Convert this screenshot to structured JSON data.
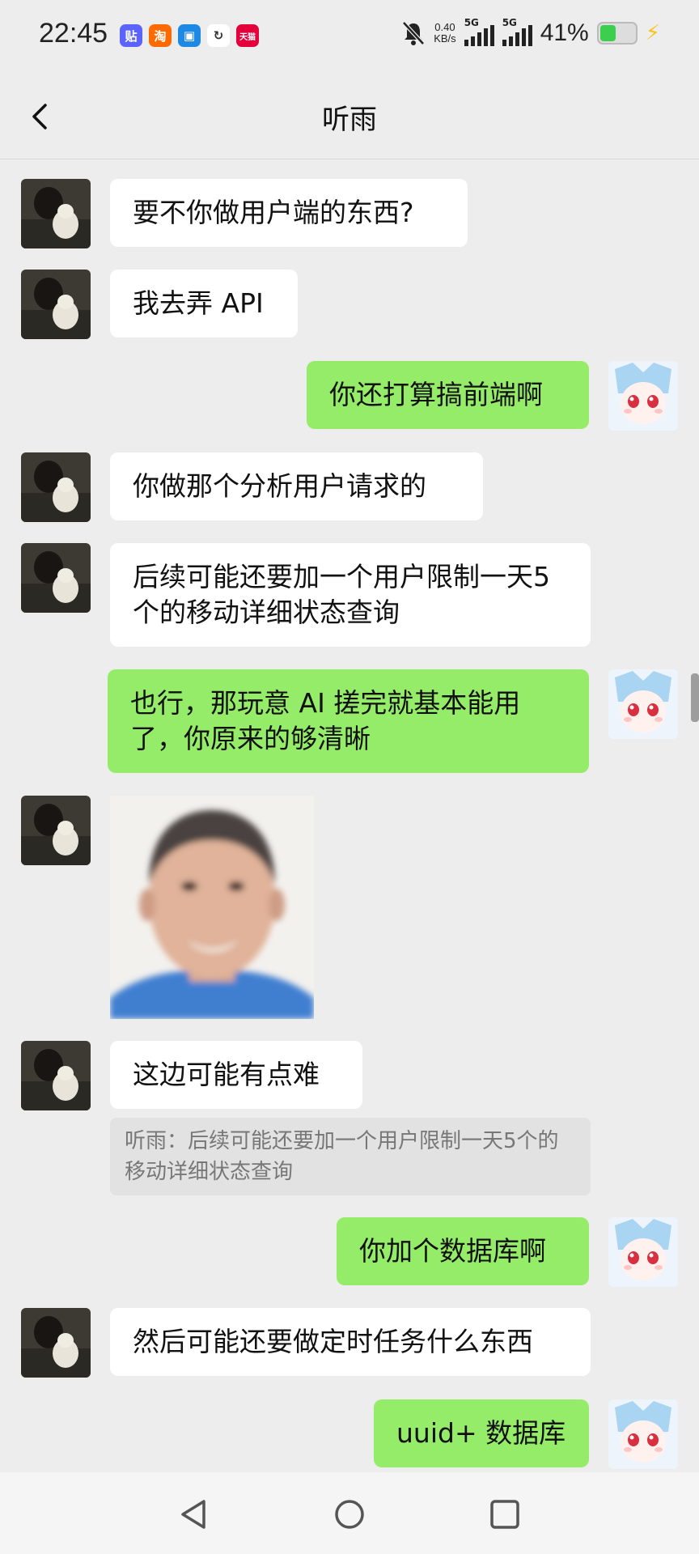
{
  "status_bar": {
    "time": "22:45",
    "apps": [
      {
        "icon": "tieba-icon",
        "label": "贴",
        "color": "#5b63ff"
      },
      {
        "icon": "taobao-icon",
        "label": "淘",
        "color": "#ff6a00"
      },
      {
        "icon": "message-app-icon",
        "label": "▣",
        "color": "#1e88e5"
      },
      {
        "icon": "link-app-icon",
        "label": "↻",
        "color": "#333333"
      },
      {
        "icon": "tmall-icon",
        "label": "天猫",
        "color": "#e4003a"
      }
    ],
    "net_speed": "0.40",
    "net_unit": "KB/s",
    "signal_label_1": "5G",
    "signal_label_2": "5G",
    "battery": "41%",
    "battery_level": 0.41
  },
  "header": {
    "title": "听雨"
  },
  "messages": [
    {
      "id": 1,
      "side": "in",
      "text": "要不你做用户端的东西?"
    },
    {
      "id": 2,
      "side": "in",
      "text": "我去弄 API"
    },
    {
      "id": 3,
      "side": "out",
      "text": "你还打算搞前端啊"
    },
    {
      "id": 4,
      "side": "in",
      "text": "你做那个分析用户请求的"
    },
    {
      "id": 5,
      "side": "in",
      "text": "后续可能还要加一个用户限制一天5个的移动详细状态查询"
    },
    {
      "id": 6,
      "side": "out",
      "text": "也行，那玩意 AI 搓完就基本能用了，你原来的够清晰"
    },
    {
      "id": 7,
      "side": "in",
      "type": "image",
      "icon": "face-photo"
    },
    {
      "id": 8,
      "side": "in",
      "text": "这边可能有点难"
    },
    {
      "id": 9,
      "type": "quote",
      "text": "听雨：后续可能还要加一个用户限制一天5个的移动详细状态查询"
    },
    {
      "id": 10,
      "side": "out",
      "text": "你加个数据库啊"
    },
    {
      "id": 11,
      "side": "in",
      "text": "然后可能还要做定时任务什么东西"
    },
    {
      "id": 12,
      "side": "out",
      "text": "uuid+ 数据库"
    }
  ],
  "colors": {
    "background": "#ededed",
    "bubble_out": "#95ec69",
    "bubble_in": "#ffffff",
    "quote_bg": "#e2e2e2"
  },
  "nav": {
    "back": "triangle-back-icon",
    "home": "circle-home-icon",
    "recents": "square-recents-icon"
  }
}
